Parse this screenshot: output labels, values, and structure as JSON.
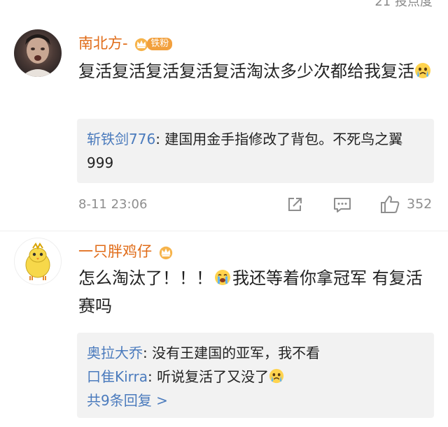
{
  "top_partial_text": "21 投点度",
  "comments": [
    {
      "username": "南北方-",
      "fan_badge": "铁粉",
      "text": "复活复活复活复活复活淘汰多少次都给我复活",
      "emoji_icon": "crying-face-emoji",
      "replies": [
        {
          "name": "斩铁剑776",
          "text": ": 建国用金手指修改了背包。不死鸟之翼 999"
        }
      ],
      "timestamp": "8-11 23:06",
      "like_count": "352"
    },
    {
      "username": "一只胖鸡仔",
      "text_part1": "怎么淘汰了！！！",
      "text_part2": "我还等着你拿冠军 有复活赛吗",
      "emoji_icon": "loudly-crying-emoji",
      "replies": [
        {
          "name": "奥拉大乔",
          "text": ": 没有王建国的亚军，我不看"
        },
        {
          "name": "口隹Kirra",
          "text": ": 听说复活了又没了"
        }
      ],
      "more_replies": "共9条回复 >"
    }
  ]
}
